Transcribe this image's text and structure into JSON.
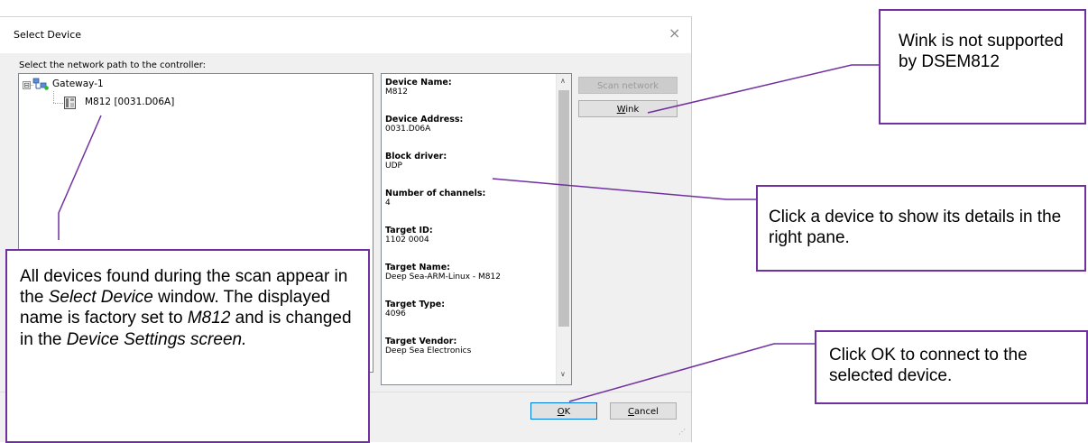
{
  "dialog": {
    "title": "Select Device",
    "close_glyph": "×",
    "prompt": "Select the network path to the controller:"
  },
  "tree": {
    "expander_glyph": "⊟",
    "gateway_label": "Gateway-1",
    "gateway_icon": "network-gateway-icon",
    "device_label": "M812 [0031.D06A]",
    "device_icon": "device-icon"
  },
  "details": {
    "fields": [
      {
        "label": "Device Name:",
        "value": "M812"
      },
      {
        "label": "Device Address:",
        "value": "0031.D06A"
      },
      {
        "label": "Block driver:",
        "value": "UDP"
      },
      {
        "label": "Number of channels:",
        "value": "4"
      },
      {
        "label": "Target ID:",
        "value": "1102 0004"
      },
      {
        "label": "Target Name:",
        "value": "Deep Sea-ARM-Linux - M812"
      },
      {
        "label": "Target Type:",
        "value": "4096"
      },
      {
        "label": "Target Vendor:",
        "value": "Deep Sea Electronics"
      }
    ],
    "scroll_up_glyph": "∧",
    "scroll_down_glyph": "∨"
  },
  "buttons": {
    "scan_network": "Scan network",
    "wink": {
      "key": "W",
      "rest": "ink"
    },
    "ok": {
      "key": "O",
      "rest": "K"
    },
    "cancel": {
      "key": "C",
      "rest": "ancel"
    }
  },
  "callouts": {
    "wink": "Wink is not supported by DSEM812",
    "click_device": "Click a device to show its details in the right pane.",
    "click_ok": "Click OK to connect to the selected device.",
    "devices": {
      "p1": "All devices found during the scan appear in the ",
      "i1": "Select Device",
      "p2": " window. The displayed name is factory set to ",
      "i2": "M812",
      "p3": " and is changed in the ",
      "i3": "Device Settings screen."
    }
  },
  "colors": {
    "callout_border": "#7030a0",
    "default_button_border": "#0078d7"
  }
}
